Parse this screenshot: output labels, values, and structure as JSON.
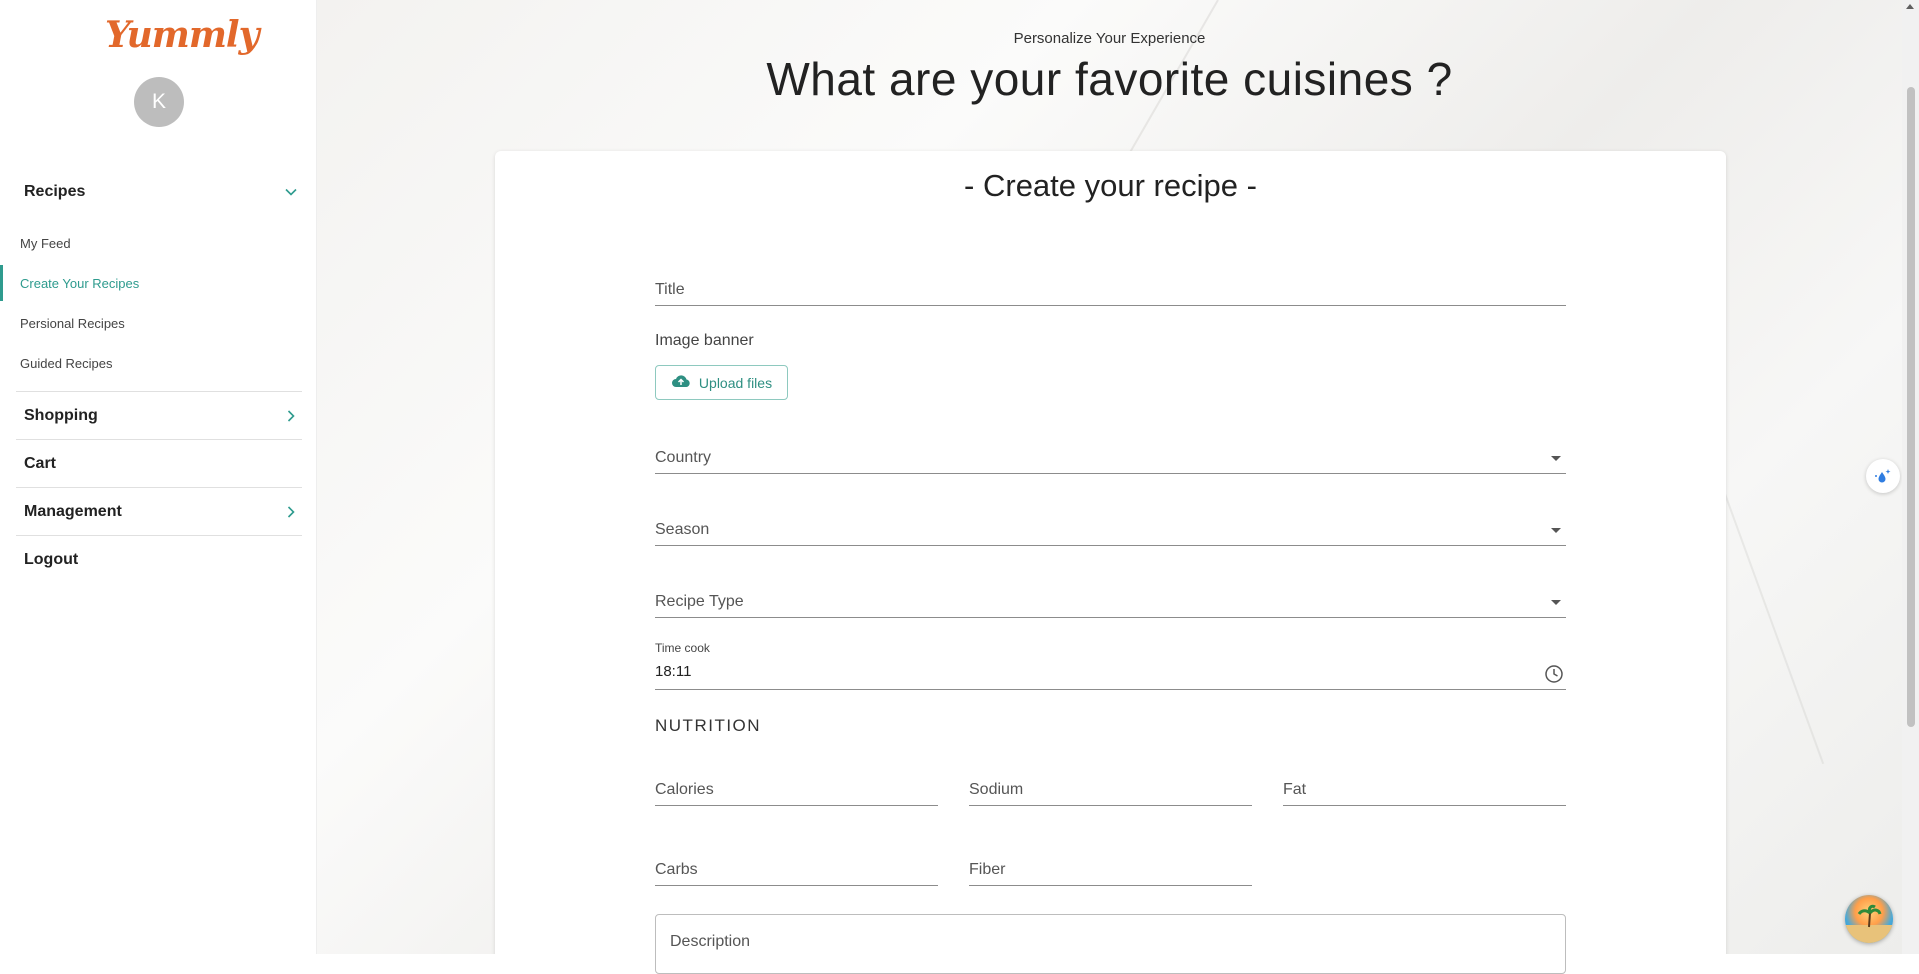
{
  "brand": {
    "logo_text": "Yummly",
    "logo_color": "#e2682b"
  },
  "user": {
    "avatar_initial": "K"
  },
  "sidebar": {
    "recipes": {
      "label": "Recipes",
      "items": [
        {
          "label": "My Feed"
        },
        {
          "label": "Create Your Recipes"
        },
        {
          "label": "Persional Recipes"
        },
        {
          "label": "Guided Recipes"
        }
      ]
    },
    "shopping": "Shopping",
    "cart": "Cart",
    "management": "Management",
    "logout": "Logout"
  },
  "header": {
    "kicker": "Personalize Your Experience",
    "title": "What are your favorite cuisines ?"
  },
  "form": {
    "title": "- Create your recipe -",
    "title_field": "Title",
    "image_banner_label": "Image banner",
    "upload_button": "Upload files",
    "country": "Country",
    "season": "Season",
    "recipe_type": "Recipe Type",
    "time_cook_label": "Time cook",
    "time_cook_value": "18:11",
    "nutrition_title": "NUTRITION",
    "nutrition": {
      "calories": "Calories",
      "sodium": "Sodium",
      "fat": "Fat",
      "carbs": "Carbs",
      "fiber": "Fiber"
    },
    "description": "Description"
  },
  "colors": {
    "accent": "#2e9b8e",
    "brand": "#e2682b"
  },
  "icons": {
    "recipes_toggle": "chevron-down-icon",
    "shopping_toggle": "chevron-right-icon",
    "management_toggle": "chevron-right-icon",
    "upload": "cloud-upload-icon",
    "time": "clock-icon",
    "floating": "sparkle-drop-icon",
    "assistant": "beach-avatar-icon"
  }
}
